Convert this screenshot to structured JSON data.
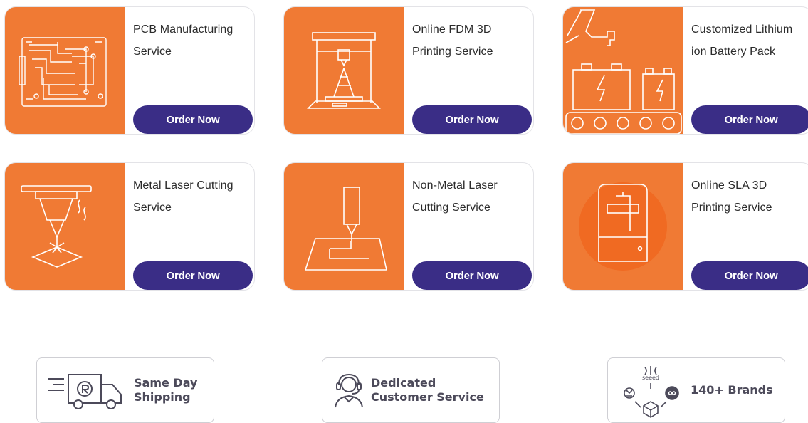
{
  "services": [
    {
      "title": "PCB Manufacturing Service",
      "button": "Order Now",
      "icon": "pcb-icon"
    },
    {
      "title": "Online FDM 3D Printing Service",
      "button": "Order Now",
      "icon": "fdm-printer-icon"
    },
    {
      "title": "Customized Lithium ion Battery Pack",
      "button": "Order Now",
      "icon": "battery-pack-icon"
    },
    {
      "title": "Metal Laser Cutting Service",
      "button": "Order Now",
      "icon": "laser-cutter-icon"
    },
    {
      "title": "Non-Metal Laser Cutting Service",
      "button": "Order Now",
      "icon": "nonmetal-laser-icon"
    },
    {
      "title": "Online SLA 3D Printing Service",
      "button": "Order Now",
      "icon": "sla-printer-icon"
    }
  ],
  "features": [
    {
      "label": "Same Day Shipping",
      "icon": "delivery-truck-icon"
    },
    {
      "label": "Dedicated Customer Service",
      "icon": "headset-agent-icon"
    },
    {
      "label": "140+ Brands",
      "icon": "brands-icon",
      "logo_text": "seeed"
    }
  ],
  "colors": {
    "accent": "#f07a34",
    "button": "#3a2d86",
    "text": "#2b2b2b"
  }
}
